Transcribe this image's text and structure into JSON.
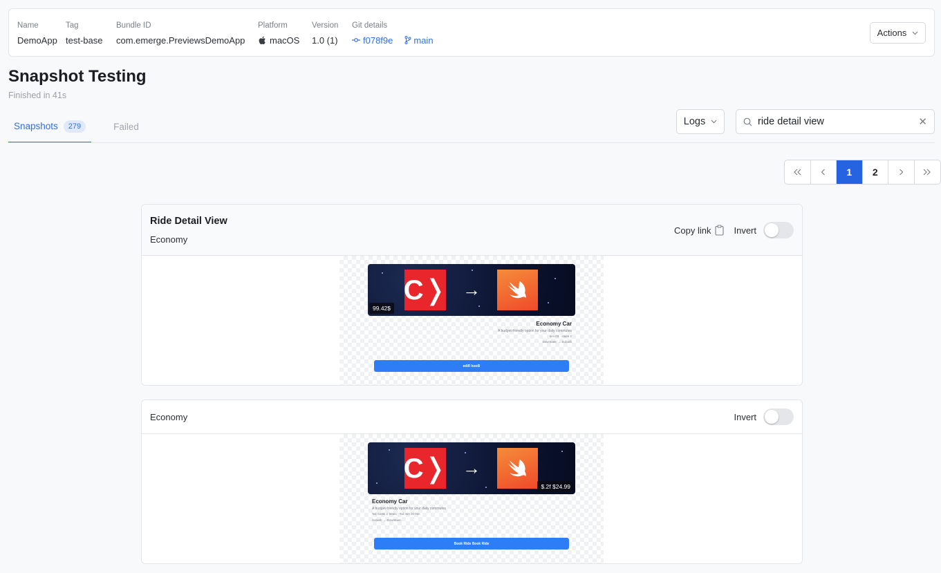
{
  "header": {
    "meta": [
      {
        "label": "Name",
        "value": "DemoApp"
      },
      {
        "label": "Tag",
        "value": "test-base"
      },
      {
        "label": "Bundle ID",
        "value": "com.emerge.PreviewsDemoApp"
      },
      {
        "label": "Platform",
        "value": "macOS",
        "icon": "apple-icon"
      },
      {
        "label": "Version",
        "value": "1.0 (1)"
      },
      {
        "label": "Git details",
        "commit": "f078f9e",
        "branch": "main"
      }
    ],
    "actions_label": "Actions"
  },
  "page": {
    "title": "Snapshot Testing",
    "subtitle": "Finished in 41s"
  },
  "tabs": [
    {
      "label": "Snapshots",
      "count": "279",
      "active": true
    },
    {
      "label": "Failed",
      "active": false
    }
  ],
  "logs_label": "Logs",
  "search": {
    "value": "ride detail view",
    "placeholder": "Search"
  },
  "pagination": {
    "pages": [
      "1",
      "2"
    ],
    "current": "1"
  },
  "snapshots": [
    {
      "title": "Ride Detail View",
      "variant": "Economy",
      "copy_link": "Copy link",
      "invert_label": "Invert",
      "invert_on": false,
      "preview": {
        "price": "99.42$",
        "ride_title": "Economy Car",
        "ride_desc": "A budget-friendly option for your daily commutes",
        "ride_meta": "nim 03  ·  stae5 2",
        "route": "Downtown  →  Suburb",
        "button": "ediR kooB"
      }
    },
    {
      "variant": "Economy",
      "invert_label": "Invert",
      "invert_on": false,
      "preview": {
        "price": "$.2f $24.99",
        "ride_title": "Economy Car",
        "ride_desc": "A budget-friendly option for your daily commutes",
        "ride_meta": "%d Seats 2 Seats  ·  %d min 30 min",
        "route": "Suburb  →  Downtown",
        "button": "Book Ride Book Ride"
      }
    }
  ],
  "colors": {
    "accent": "#2563e0",
    "brand_red": "#e8262c",
    "swift_orange": "#f05138",
    "book_button": "#2f7df6"
  }
}
